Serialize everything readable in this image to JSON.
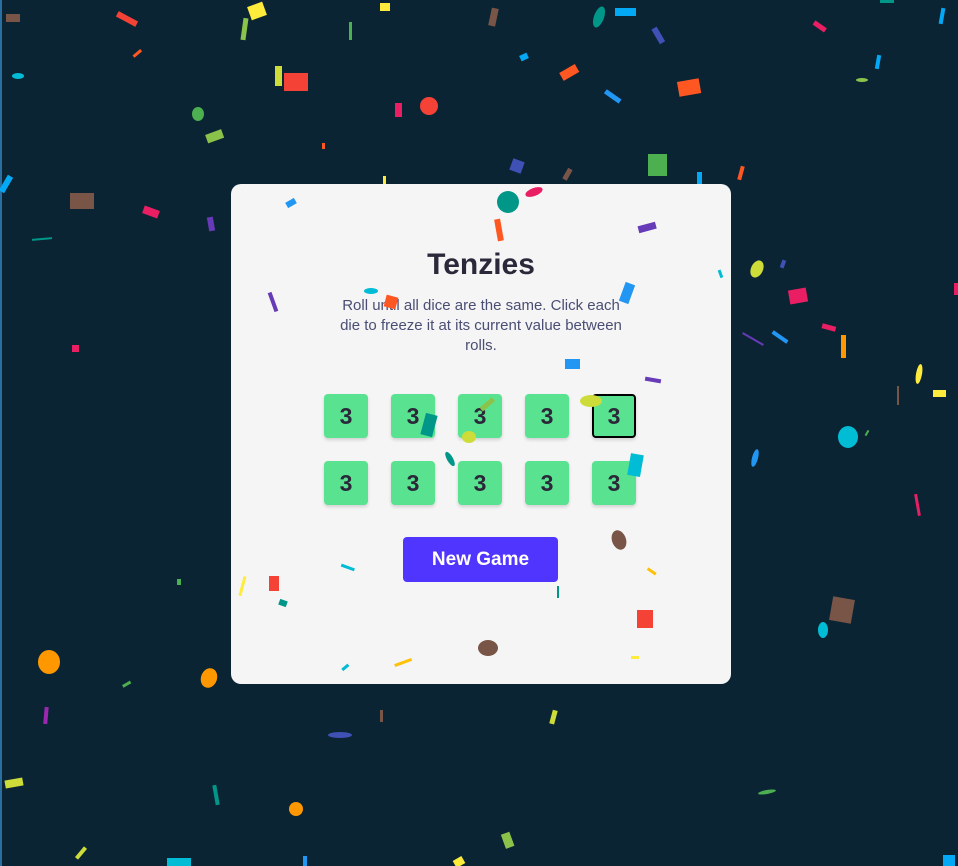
{
  "app": {
    "title": "Tenzies",
    "instructions": "Roll until all dice are the same. Click each die to freeze it at its current value between rolls.",
    "new_game_label": "New Game"
  },
  "dice": [
    {
      "value": "3",
      "held": false
    },
    {
      "value": "3",
      "held": false
    },
    {
      "value": "3",
      "held": false
    },
    {
      "value": "3",
      "held": false
    },
    {
      "value": "3",
      "held": true
    },
    {
      "value": "3",
      "held": false
    },
    {
      "value": "3",
      "held": false
    },
    {
      "value": "3",
      "held": false
    },
    {
      "value": "3",
      "held": false
    },
    {
      "value": "3",
      "held": false
    }
  ],
  "colors": {
    "background": "#0b2434",
    "card": "#f5f5f5",
    "die": "#59e391",
    "button": "#5035ff",
    "title": "#2b283a",
    "instructions": "#4a4e74"
  }
}
